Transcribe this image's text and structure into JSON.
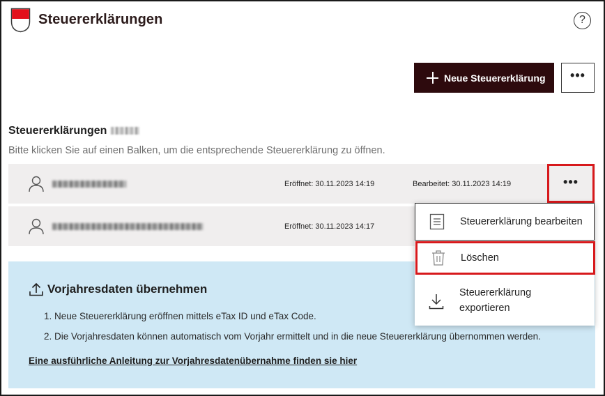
{
  "header": {
    "title": "Steuererklärungen",
    "help_label": "?"
  },
  "toolbar": {
    "new_label": "Neue Steuererklärung",
    "more_label": "•••"
  },
  "section": {
    "title": "Steuererklärungen",
    "hint": "Bitte klicken Sie auf einen Balken, um die entsprechende Steuererklärung zu öffnen."
  },
  "rows": [
    {
      "opened": "Eröffnet: 30.11.2023 14:19",
      "edited": "Bearbeitet: 30.11.2023 14:19"
    },
    {
      "opened": "Eröffnet: 30.11.2023 14:17"
    }
  ],
  "row_more_label": "•••",
  "menu": {
    "edit": "Steuererklärung bearbeiten",
    "delete": "Löschen",
    "export_line1": "Steuererklärung",
    "export_line2": "exportieren"
  },
  "info": {
    "title": "Vorjahresdaten übernehmen",
    "step1": "1. Neue Steuererklärung eröffnen mittels eTax ID und eTax Code.",
    "step2": "2. Die Vorjahresdaten können automatisch vom Vorjahr ermittelt und in die neue Steuererklärung übernommen werden.",
    "link": "Eine ausführliche Anleitung zur Vorjahresdatenübernahme finden sie hier"
  },
  "colors": {
    "primary": "#2d0a0d",
    "highlight": "#d7191c",
    "info_bg": "#cfe8f5",
    "row_bg": "#f0eeee"
  },
  "icons": [
    "canton-logo",
    "help-icon",
    "plus-icon",
    "more-icon",
    "person-icon",
    "document-icon",
    "trash-icon",
    "download-icon",
    "upload-icon"
  ]
}
